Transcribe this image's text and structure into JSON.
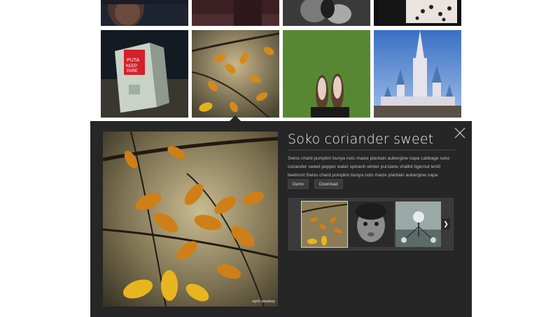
{
  "grid": {
    "items": [
      {
        "name": "boy-portrait-photo"
      },
      {
        "name": "dark-maroon-photo"
      },
      {
        "name": "hands-bw-photo"
      },
      {
        "name": "leopard-pattern-photo"
      },
      {
        "name": "keep-calm-box-photo"
      },
      {
        "name": "autumn-leaves-photo"
      },
      {
        "name": "shoes-on-grass-photo"
      },
      {
        "name": "castle-photo"
      }
    ]
  },
  "preview": {
    "title": "Soko coriander sweet",
    "description": "Swiss chard pumpkin bunya nuts maize plantain aubergine napa cabbage soko coriander sweet pepper water spinach winter purslane shallot tigernut lentil beetroot.Swiss chard pumpkin bunya nuts maize plantain aubergine napa cabbage.",
    "watermark": "april pixabay",
    "demo_label": "Demo",
    "download_label": "Download",
    "next_icon": "chevron-right-icon",
    "close_icon": "close-icon",
    "thumbnails": [
      "autumn-leaves-thumb",
      "child-portrait-thumb",
      "sphere-building-thumb"
    ]
  },
  "book_sign_text": "PUTA KEEP PARE"
}
